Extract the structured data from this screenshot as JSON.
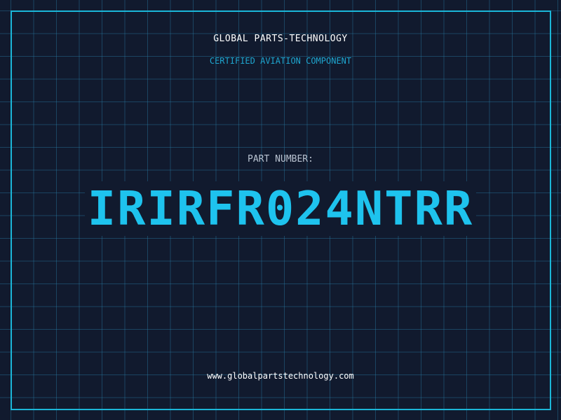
{
  "header": {
    "company": "GLOBAL PARTS-TECHNOLOGY",
    "subtitle": "CERTIFIED AVIATION COMPONENT"
  },
  "main": {
    "label": "PART NUMBER:",
    "part_number": "IRIRFR024NTRR"
  },
  "footer": {
    "website": "www.globalpartstechnology.com"
  },
  "colors": {
    "background": "#111a2e",
    "grid": "#287898",
    "frame": "#1bb6d8",
    "accent": "#1ec3ee",
    "subtitle": "#1ea6d0"
  }
}
